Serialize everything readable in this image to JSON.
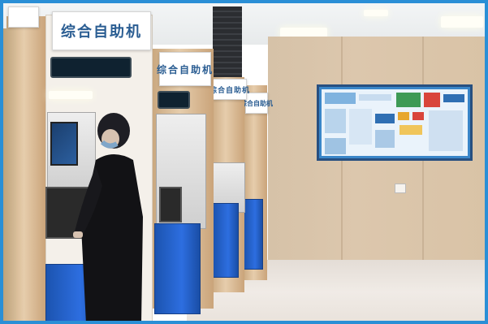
{
  "photo": {
    "frame_color": "#2a8fd6",
    "signs": [
      {
        "text": "综合自助机"
      },
      {
        "text": "综合自助机"
      },
      {
        "text": "综合自助机"
      },
      {
        "text": "综合自助机"
      }
    ]
  }
}
